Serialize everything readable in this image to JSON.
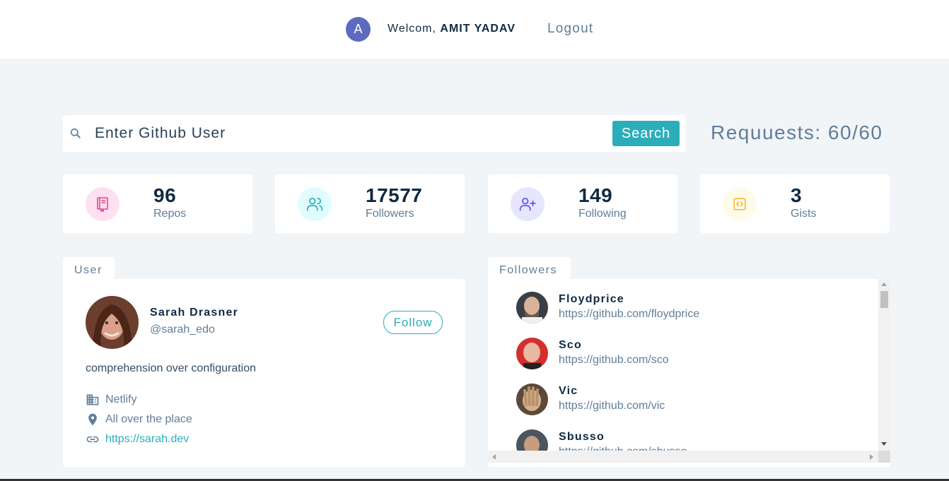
{
  "nav": {
    "avatar_letter": "A",
    "welcome_prefix": "Welcom,",
    "user_name": "AMIT YADAV",
    "logout_label": "Logout"
  },
  "search": {
    "placeholder": "Enter Github User",
    "button_label": "Search",
    "requests_text": "Requuests: 60/60"
  },
  "stats": [
    {
      "value": "96",
      "label": "Repos",
      "icon": "book-icon",
      "color": "#da4a91",
      "bg": "#ffe0f0"
    },
    {
      "value": "17577",
      "label": "Followers",
      "icon": "users-icon",
      "color": "#2caeba",
      "bg": "#e0fcff"
    },
    {
      "value": "149",
      "label": "Following",
      "icon": "user-plus-icon",
      "color": "#5d55fa",
      "bg": "#e6e6ff"
    },
    {
      "value": "3",
      "label": "Gists",
      "icon": "code-icon",
      "color": "#f0b429",
      "bg": "#fffbea"
    }
  ],
  "user_panel": {
    "tab_label": "User",
    "name": "Sarah Drasner",
    "handle": "@sarah_edo",
    "follow_label": "Follow",
    "bio": "comprehension over configuration",
    "company": "Netlify",
    "location": "All over the place",
    "blog": "https://sarah.dev"
  },
  "followers_panel": {
    "tab_label": "Followers",
    "items": [
      {
        "name": "Floydprice",
        "url": "https://github.com/floydprice"
      },
      {
        "name": "Sco",
        "url": "https://github.com/sco"
      },
      {
        "name": "Vic",
        "url": "https://github.com/vic"
      },
      {
        "name": "Sbusso",
        "url": "https://github.com/sbusso"
      }
    ]
  }
}
